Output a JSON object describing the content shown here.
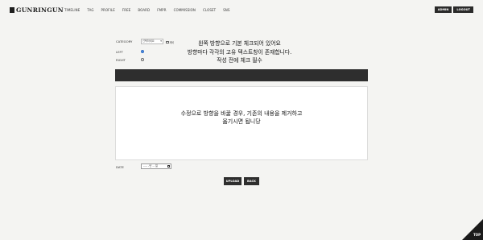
{
  "header": {
    "logo_text": "GUNRINGUN",
    "nav": [
      "TIMELINE",
      "TAG",
      "PROFILE",
      "FREE",
      "BOARD",
      "FMPR",
      "COMMISSION",
      "CLOSET",
      "SNS"
    ],
    "admin_label": "ADMIN",
    "logout_label": "LOGOUT"
  },
  "form": {
    "category_label": "CATEGORY",
    "category_value": "선택하세요",
    "category_check_label": "제비",
    "left_label": "LEFT",
    "right_label": "RIGHT",
    "left_selected": true,
    "notice_lines": [
      "왼쪽 방향으로 기본 체크되어 있어요",
      "방향마다 각각의 고유 텍스트창이 존재합니다.",
      "작성 전에 체크 필수"
    ],
    "textarea_lines": [
      "수정으로 방향을 바꿀 경우, 기존의 내용을 제거하고",
      "옮기시면 됩니당"
    ],
    "date_label": "DATE",
    "date_value": "---- -년 -- 일",
    "upload_label": "UPLOAD",
    "back_label": "BACK"
  },
  "footer": {
    "top_label": "TOP"
  },
  "colors": {
    "background": "#f4f4f2",
    "dark": "#2e2e2e",
    "radio_selected": "#4d8ee8"
  }
}
